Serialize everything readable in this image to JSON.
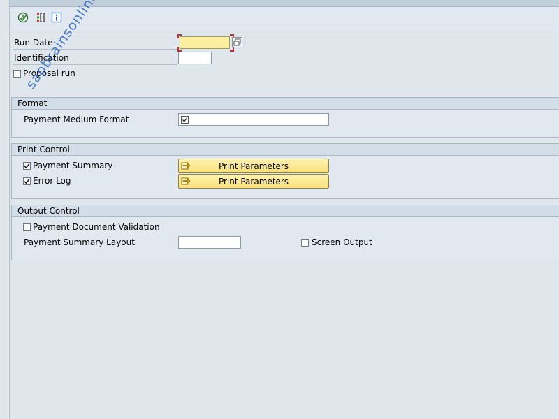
{
  "fields": {
    "run_date_label": "Run Date",
    "run_date_value": "",
    "identification_label": "Identification",
    "identification_value": "",
    "proposal_run_label": "Proposal run",
    "proposal_run_checked": false
  },
  "format": {
    "header": "Format",
    "payment_medium_format_label": "Payment Medium Format",
    "payment_medium_format_value": ""
  },
  "print_control": {
    "header": "Print Control",
    "payment_summary_label": "Payment Summary",
    "payment_summary_checked": true,
    "error_log_label": "Error Log",
    "error_log_checked": true,
    "print_parameters_label": "Print Parameters"
  },
  "output_control": {
    "header": "Output Control",
    "payment_document_validation_label": "Payment Document Validation",
    "payment_document_validation_checked": false,
    "payment_summary_layout_label": "Payment Summary Layout",
    "payment_summary_layout_value": "",
    "screen_output_label": "Screen Output",
    "screen_output_checked": false
  },
  "watermark": "sapbrainsonline.com",
  "toolbar": {
    "icons": [
      "execute-icon",
      "selection-options-icon",
      "information-icon"
    ]
  },
  "colors": {
    "background": "#dfe6ec",
    "required_field": "#fcee9e",
    "button": "#f9e07a",
    "watermark": "#2f67c0"
  }
}
